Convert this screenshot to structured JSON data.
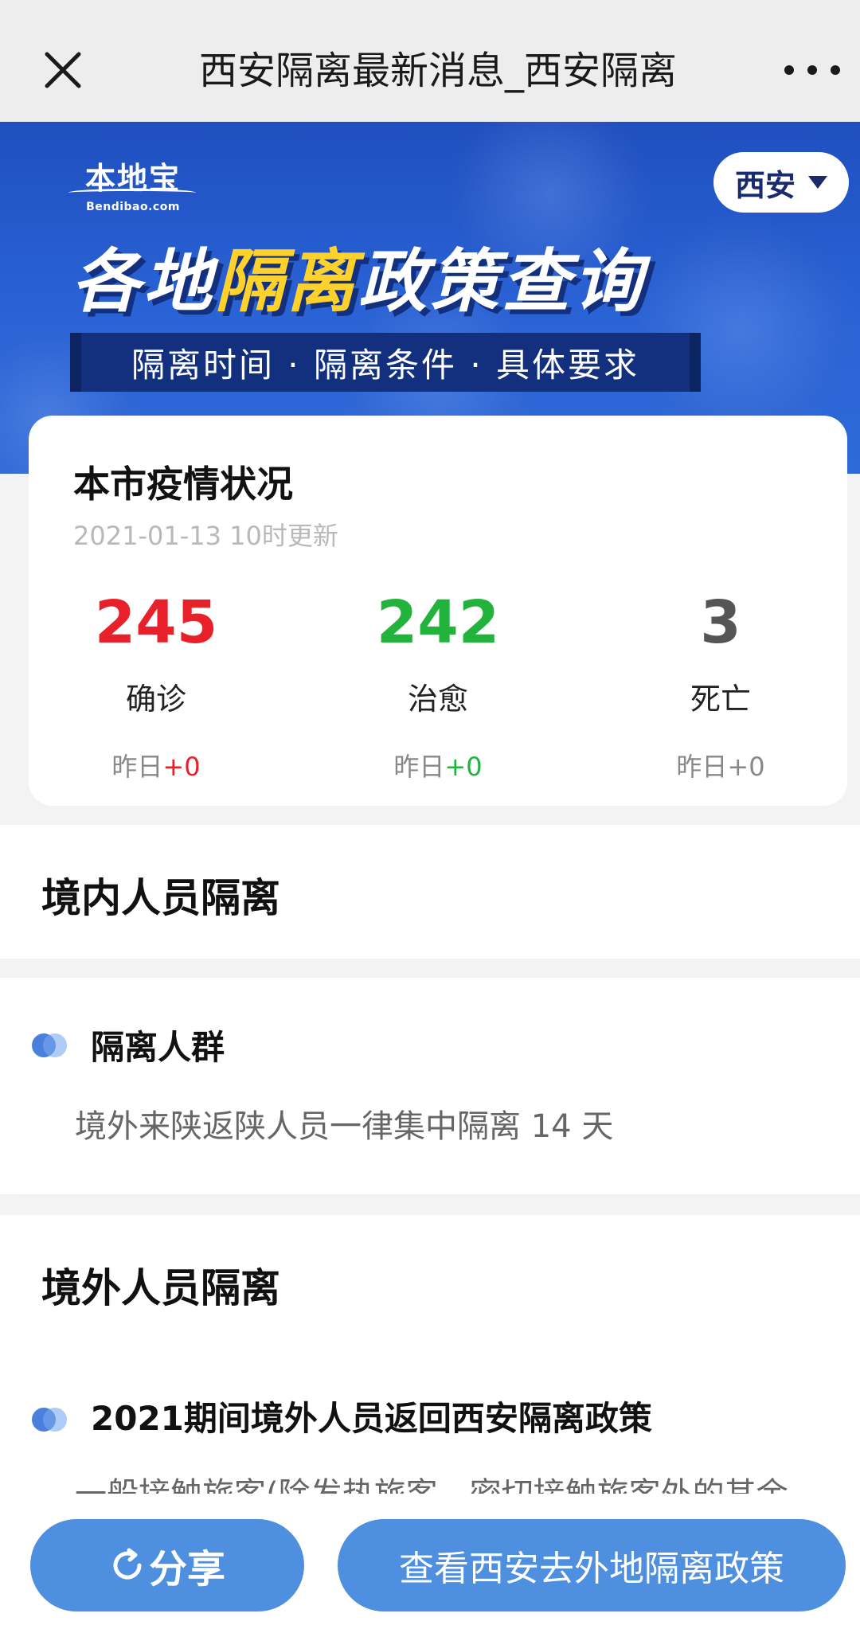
{
  "topbar": {
    "title": "西安隔离最新消息_西安隔离"
  },
  "banner": {
    "logo_cn": "本地宝",
    "logo_en": "Bendibao.com",
    "city": "西安",
    "headline_part1": "各地",
    "headline_highlight": "隔离",
    "headline_part2": "政策查询",
    "subtitle": "隔离时间 · 隔离条件 · 具体要求"
  },
  "stats": {
    "title": "本市疫情状况",
    "updated": "2021-01-13 10时更新",
    "items": [
      {
        "value": "245",
        "label": "确诊",
        "delta_prefix": "昨日",
        "delta": "+0"
      },
      {
        "value": "242",
        "label": "治愈",
        "delta_prefix": "昨日",
        "delta": "+0"
      },
      {
        "value": "3",
        "label": "死亡",
        "delta_prefix": "昨日",
        "delta": "+0"
      }
    ],
    "colors": {
      "confirmed": "#e8202a",
      "cured": "#22b33c",
      "dead": "#555555"
    }
  },
  "domestic": {
    "heading": "境内人员隔离",
    "item_title": "隔离人群",
    "item_desc": "境外来陕返陕人员一律集中隔离 14 天"
  },
  "abroad": {
    "heading": "境外人员隔离",
    "item_title": "2021期间境外人员返回西安隔离政策",
    "item_desc": "一般接触旅客(除发热旅客、密切接触旅客外的其余"
  },
  "bottom": {
    "share_label": "分享",
    "policy_label": "查看西安去外地隔离政策"
  }
}
